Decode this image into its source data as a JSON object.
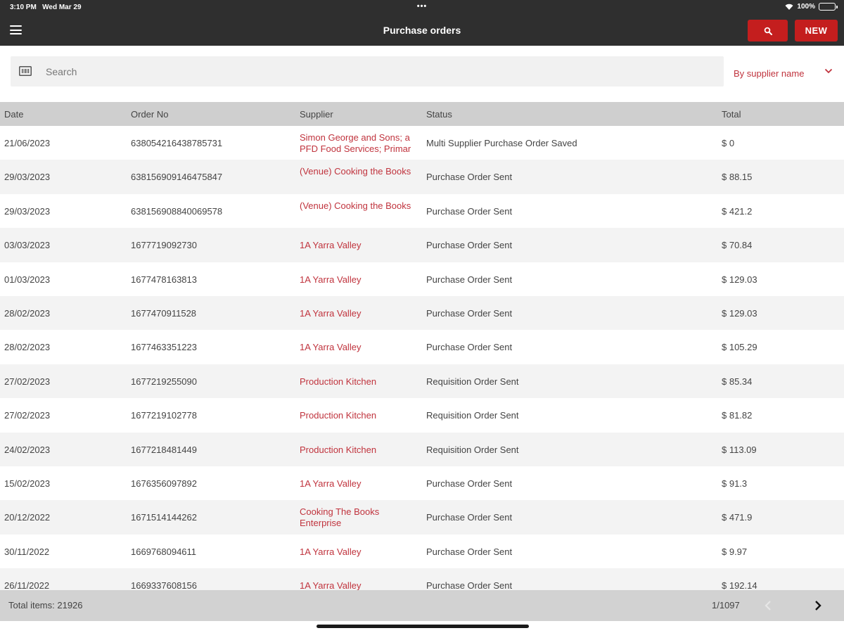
{
  "status_bar": {
    "time": "3:10 PM",
    "date": "Wed Mar 29",
    "dots": "•••",
    "battery": "100%"
  },
  "header": {
    "title": "Purchase orders",
    "search_icon": "search-icon",
    "new_label": "NEW",
    "accent_color": "#c41e1e",
    "bar_color": "#2f2f2f"
  },
  "search": {
    "placeholder": "Search",
    "value": "",
    "filter_selected": "By supplier name"
  },
  "table": {
    "columns": [
      "Date",
      "Order No",
      "Supplier",
      "Status",
      "Total"
    ],
    "rows": [
      {
        "date": "21/06/2023",
        "order_no": "638054216438785731",
        "supplier": "Simon George and Sons; a PFD Food Services; Primar",
        "status": "Multi Supplier Purchase Order Saved",
        "total": "$ 0"
      },
      {
        "date": "29/03/2023",
        "order_no": "638156909146475847",
        "supplier": "(Venue) Cooking the Books",
        "status": "Purchase Order Sent",
        "total": "$ 88.15"
      },
      {
        "date": "29/03/2023",
        "order_no": "638156908840069578",
        "supplier": "(Venue) Cooking the Books",
        "status": "Purchase Order Sent",
        "total": "$ 421.2"
      },
      {
        "date": "03/03/2023",
        "order_no": "1677719092730",
        "supplier": "1A Yarra Valley",
        "status": "Purchase Order Sent",
        "total": "$ 70.84"
      },
      {
        "date": "01/03/2023",
        "order_no": "1677478163813",
        "supplier": "1A Yarra Valley",
        "status": "Purchase Order Sent",
        "total": "$ 129.03"
      },
      {
        "date": "28/02/2023",
        "order_no": "1677470911528",
        "supplier": "1A Yarra Valley",
        "status": "Purchase Order Sent",
        "total": "$ 129.03"
      },
      {
        "date": "28/02/2023",
        "order_no": "1677463351223",
        "supplier": "1A Yarra Valley",
        "status": "Purchase Order Sent",
        "total": "$ 105.29"
      },
      {
        "date": "27/02/2023",
        "order_no": "1677219255090",
        "supplier": "Production Kitchen",
        "status": "Requisition Order Sent",
        "total": "$ 85.34"
      },
      {
        "date": "27/02/2023",
        "order_no": "1677219102778",
        "supplier": "Production Kitchen",
        "status": "Requisition Order Sent",
        "total": "$ 81.82"
      },
      {
        "date": "24/02/2023",
        "order_no": "1677218481449",
        "supplier": "Production Kitchen",
        "status": "Requisition Order Sent",
        "total": "$ 113.09"
      },
      {
        "date": "15/02/2023",
        "order_no": "1676356097892",
        "supplier": "1A Yarra Valley",
        "status": "Purchase Order Sent",
        "total": "$ 91.3"
      },
      {
        "date": "20/12/2022",
        "order_no": "1671514144262",
        "supplier": "Cooking The Books Enterprise",
        "status": "Purchase Order Sent",
        "total": "$ 471.9"
      },
      {
        "date": "30/11/2022",
        "order_no": "1669768094611",
        "supplier": "1A Yarra Valley",
        "status": "Purchase Order Sent",
        "total": "$ 9.97"
      },
      {
        "date": "26/11/2022",
        "order_no": "1669337608156",
        "supplier": "1A Yarra Valley",
        "status": "Purchase Order Sent",
        "total": "$ 192.14"
      }
    ]
  },
  "footer": {
    "total_items": "Total items: 21926",
    "page": "1/1097",
    "prev_icon": "chevron-left-icon",
    "next_icon": "chevron-right-icon"
  }
}
